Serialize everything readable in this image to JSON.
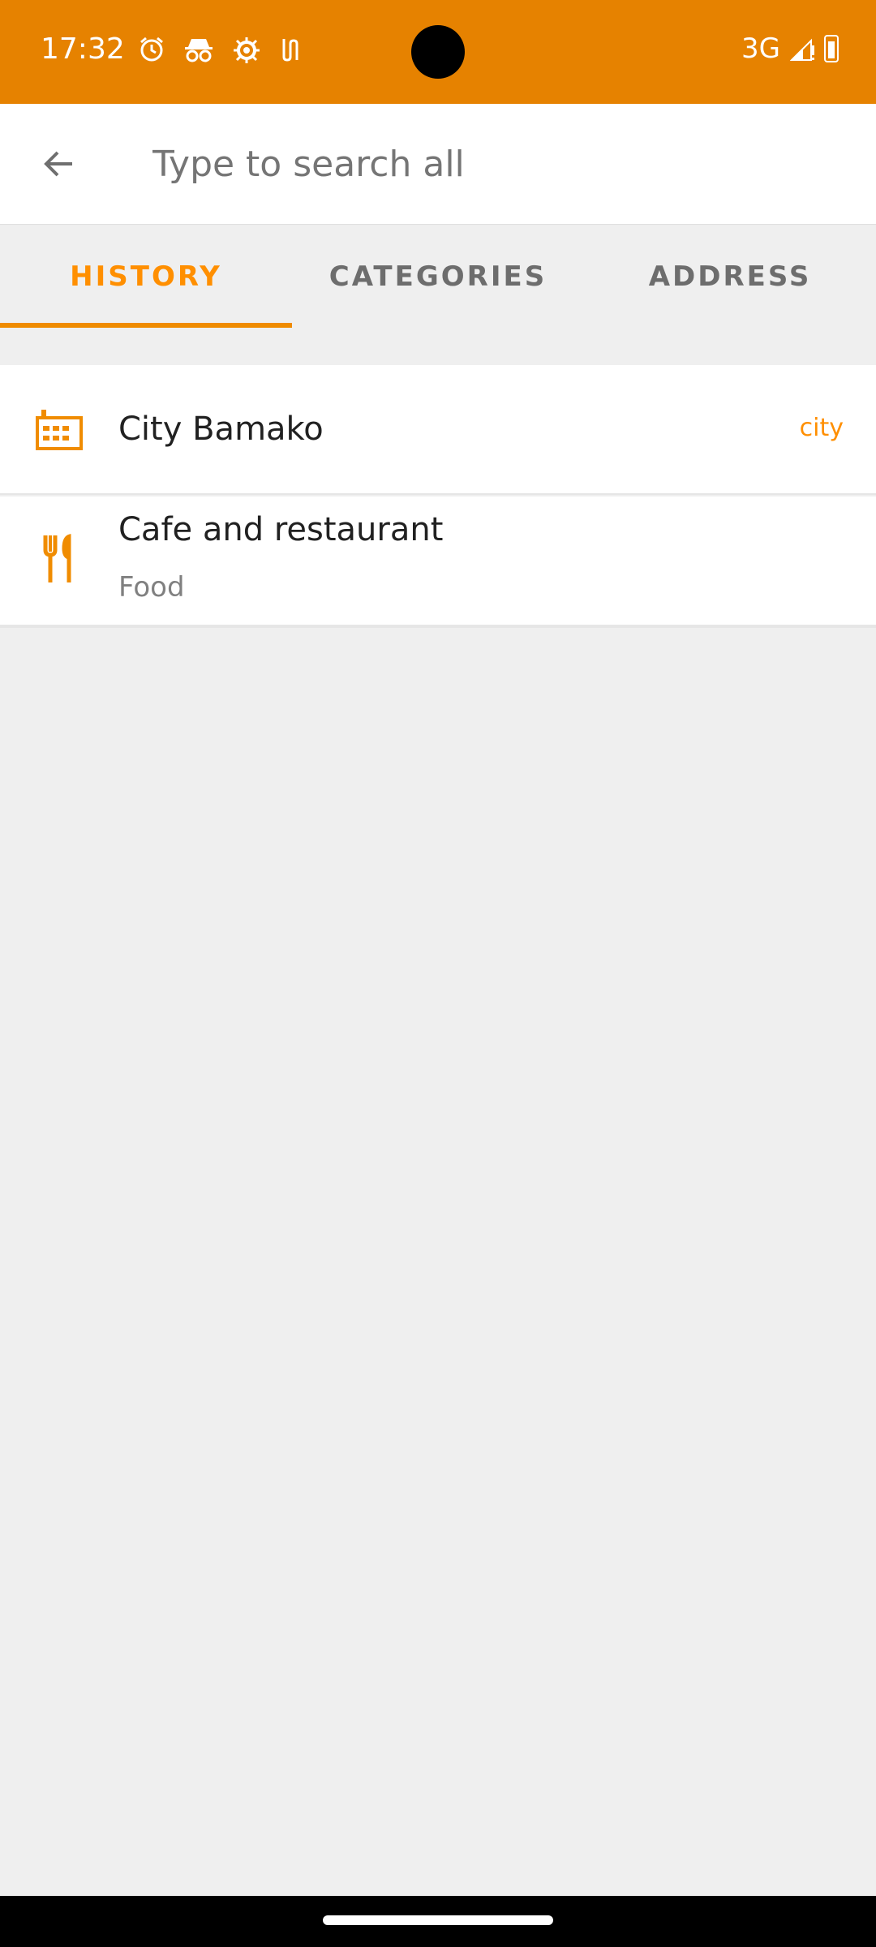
{
  "status_bar": {
    "time": "17:32",
    "icons": [
      "alarm-icon",
      "incognito-icon",
      "gear-icon",
      "wifi-calling-icon"
    ],
    "network": "3G",
    "colors": {
      "background": "#e68200"
    }
  },
  "search": {
    "placeholder": "Type to search all"
  },
  "tabs": [
    {
      "label": "HISTORY",
      "active": true
    },
    {
      "label": "CATEGORIES",
      "active": false
    },
    {
      "label": "ADDRESS",
      "active": false
    }
  ],
  "history": [
    {
      "icon": "city-icon",
      "title": "City Bamako",
      "badge": "city"
    },
    {
      "icon": "cutlery-icon",
      "title": "Cafe and restaurant",
      "subtitle": "Food"
    }
  ],
  "colors": {
    "accent": "#ff8f00",
    "tab_text": "#6d6d6d"
  }
}
